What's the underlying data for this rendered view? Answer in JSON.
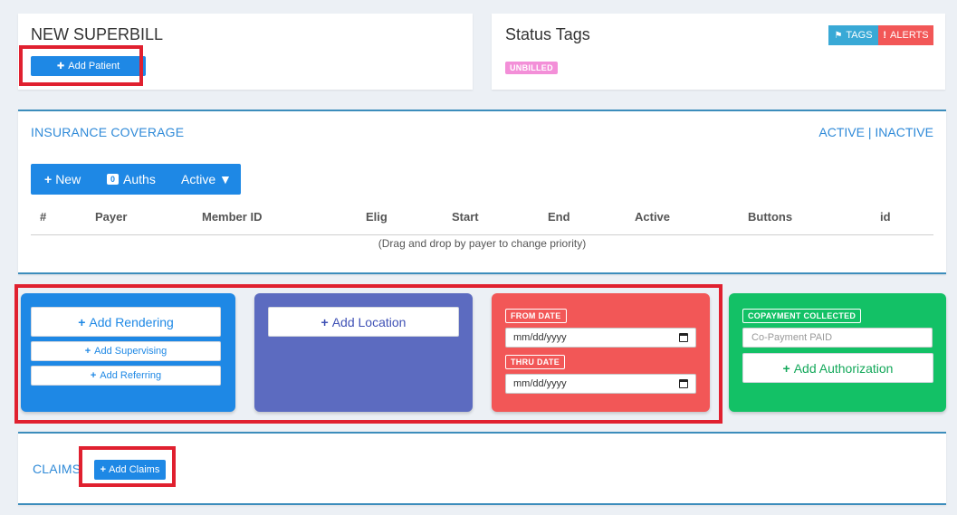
{
  "superbill": {
    "title": "NEW SUPERBILL",
    "add_patient": "Add Patient"
  },
  "status": {
    "title": "Status Tags",
    "tags_label": "TAGS",
    "alerts_label": "ALERTS",
    "unbilled": "UNBILLED"
  },
  "insurance": {
    "title": "INSURANCE COVERAGE",
    "active": "ACTIVE",
    "separator": "|",
    "inactive": "INACTIVE",
    "toolbar": {
      "new": "New",
      "auths_count": "0",
      "auths": "Auths",
      "active": "Active ▼"
    },
    "columns": [
      "#",
      "Payer",
      "Member ID",
      "Elig",
      "Start",
      "End",
      "Active",
      "Buttons",
      "id"
    ],
    "empty_hint": "(Drag and drop by payer to change priority)"
  },
  "providers": {
    "add_rendering": "Add Rendering",
    "add_supervising": "Add Supervising",
    "add_referring": "Add Referring"
  },
  "location": {
    "add_location": "Add Location"
  },
  "dates": {
    "from_label": "FROM DATE",
    "from_value": "mm/dd/yyyy",
    "thru_label": "THRU DATE",
    "thru_value": "mm/dd/yyyy"
  },
  "copay": {
    "label": "COPAYMENT COLLECTED",
    "placeholder": "Co-Payment PAID",
    "add_authorization": "Add Authorization"
  },
  "claims": {
    "title": "CLAIMS",
    "add_claims": "Add Claims"
  },
  "colors": {
    "blue": "#1e88e5",
    "indigo": "#5c6bc0",
    "red": "#f25757",
    "green": "#13c166",
    "highlight": "#e0202f"
  }
}
